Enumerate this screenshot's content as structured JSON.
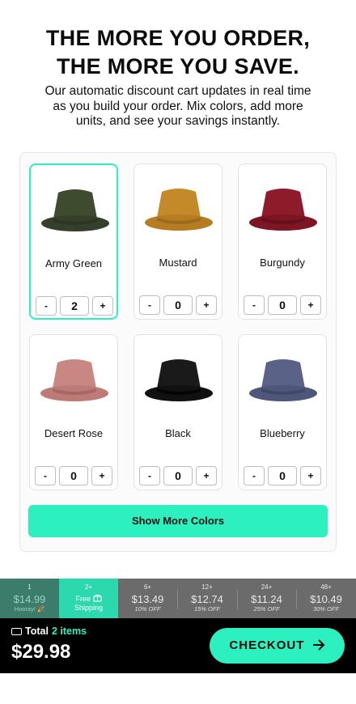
{
  "headline": {
    "line1": "THE MORE YOU ORDER,",
    "line2": "THE MORE YOU SAVE."
  },
  "subtext": "Our automatic discount cart updates in real time as you build your order. Mix colors, add more units, and see your savings instantly.",
  "products": [
    {
      "name": "Army Green",
      "qty": "2",
      "color": "#3f4b2f",
      "selected": true
    },
    {
      "name": "Mustard",
      "qty": "0",
      "color": "#c48a2a"
    },
    {
      "name": "Burgundy",
      "qty": "0",
      "color": "#8e1b2a"
    },
    {
      "name": "Desert Rose",
      "qty": "0",
      "color": "#c98784"
    },
    {
      "name": "Black",
      "qty": "0",
      "color": "#1a1a1a"
    },
    {
      "name": "Blueberry",
      "qty": "0",
      "color": "#5a6288"
    }
  ],
  "qty_minus": "-",
  "qty_plus": "+",
  "show_more_label": "Show More Colors",
  "tiers": [
    {
      "qty": "1",
      "price": "$14.99",
      "note": "Hooray! 🎉"
    },
    {
      "qty": "2+",
      "free": "Free",
      "free2": "Shipping"
    },
    {
      "qty": "6+",
      "price": "$13.49",
      "note": "10% OFF"
    },
    {
      "qty": "12+",
      "price": "$12.74",
      "note": "15% OFF"
    },
    {
      "qty": "24+",
      "price": "$11.24",
      "note": "25% OFF"
    },
    {
      "qty": "48+",
      "price": "$10.49",
      "note": "30% OFF"
    }
  ],
  "footer": {
    "total_label": "Total",
    "items": "2 items",
    "total_price": "$29.98",
    "checkout_label": "CHECKOUT"
  },
  "colors": {
    "accent": "#2cf0bf",
    "footer_bg": "#000000",
    "tier_bg": "#6b6b6b"
  },
  "icons": [
    "tag-icon",
    "box-icon",
    "arrow-right-icon",
    "bucket-hat-icon"
  ]
}
